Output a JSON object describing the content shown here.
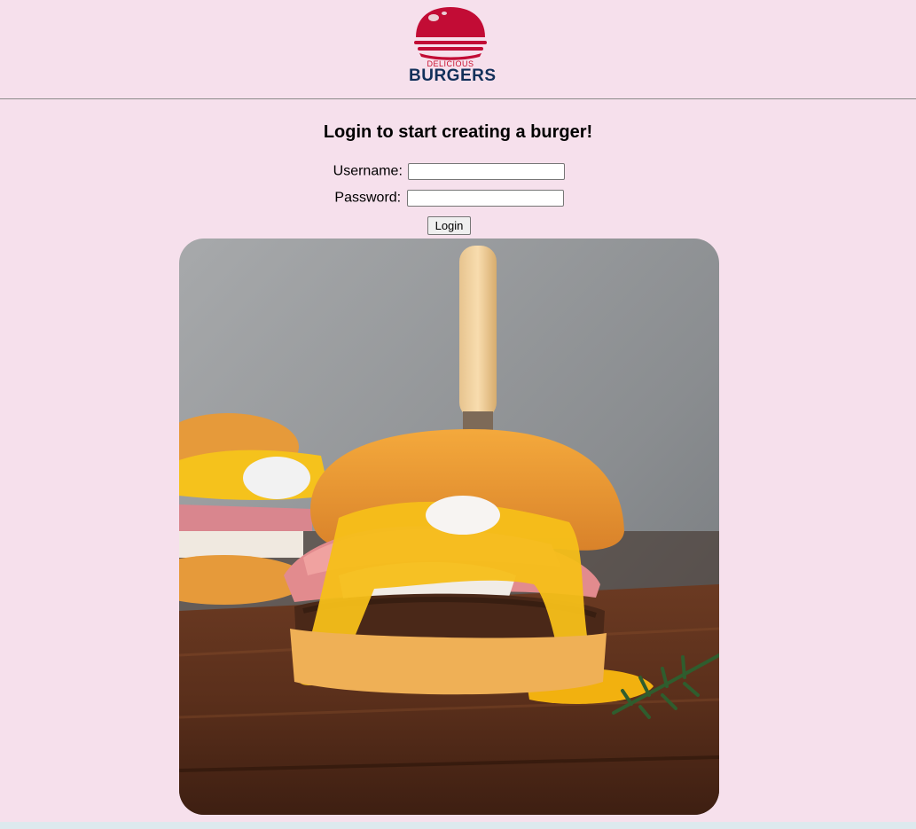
{
  "header": {
    "logo": {
      "icon": "burger-icon",
      "top_text": "DELICIOUS",
      "main_text": "BURGERS"
    }
  },
  "main": {
    "title": "Login to start creating a burger!",
    "username_label": "Username:",
    "username_value": "",
    "password_label": "Password:",
    "password_value": "",
    "login_button": "Login",
    "hero_image": "burger-photo"
  },
  "colors": {
    "background": "#f6e0ec",
    "logo_red": "#c8102e",
    "logo_navy": "#12305a"
  }
}
